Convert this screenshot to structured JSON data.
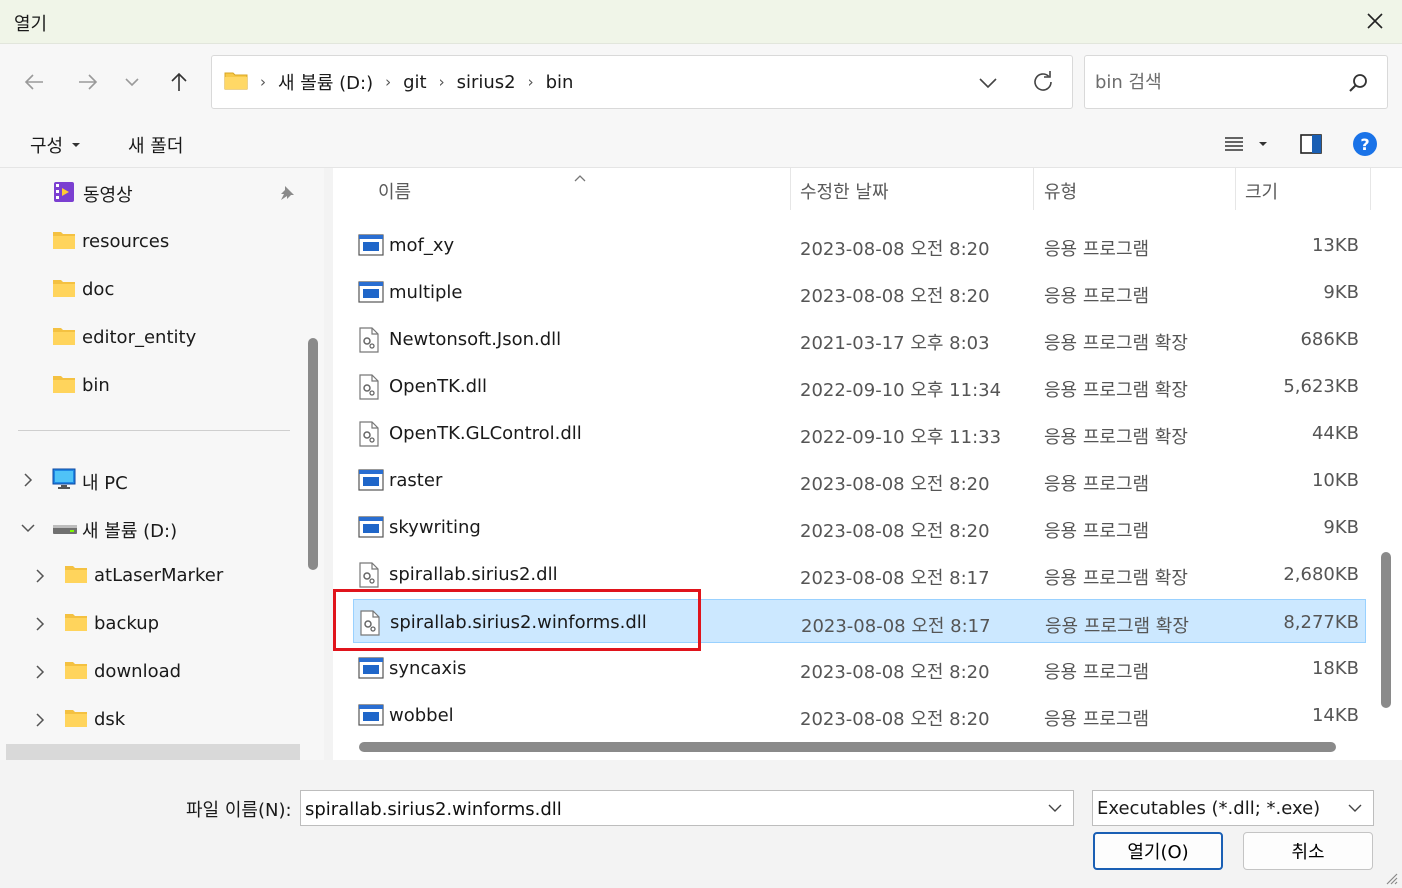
{
  "window": {
    "title": "열기"
  },
  "nav": {
    "breadcrumbs": [
      "새 볼륨 (D:)",
      "git",
      "sirius2",
      "bin"
    ],
    "search_placeholder": "bin 검색"
  },
  "toolbar": {
    "organize_label": "구성",
    "new_folder_label": "새 폴더"
  },
  "sidebar": {
    "quick": [
      {
        "label": "동영상",
        "icon": "video-folder-icon",
        "pinned": true
      },
      {
        "label": "resources",
        "icon": "folder-icon"
      },
      {
        "label": "doc",
        "icon": "folder-icon"
      },
      {
        "label": "editor_entity",
        "icon": "folder-icon"
      },
      {
        "label": "bin",
        "icon": "folder-icon"
      }
    ],
    "tree": [
      {
        "label": "내 PC",
        "icon": "pc-icon",
        "expanded": false
      },
      {
        "label": "새 볼륨 (D:)",
        "icon": "drive-icon",
        "expanded": true
      },
      {
        "label": "atLaserMarker",
        "icon": "folder-icon"
      },
      {
        "label": "backup",
        "icon": "folder-icon"
      },
      {
        "label": "download",
        "icon": "folder-icon"
      },
      {
        "label": "dsk",
        "icon": "folder-icon"
      }
    ]
  },
  "columns": {
    "name": "이름",
    "date": "수정한 날짜",
    "type": "유형",
    "size": "크기"
  },
  "files": [
    {
      "name": "mof_xy",
      "date": "2023-08-08 오전 8:20",
      "type": "응용 프로그램",
      "size": "13KB",
      "kind": "exe"
    },
    {
      "name": "multiple",
      "date": "2023-08-08 오전 8:20",
      "type": "응용 프로그램",
      "size": "9KB",
      "kind": "exe"
    },
    {
      "name": "Newtonsoft.Json.dll",
      "date": "2021-03-17 오후 8:03",
      "type": "응용 프로그램 확장",
      "size": "686KB",
      "kind": "dll"
    },
    {
      "name": "OpenTK.dll",
      "date": "2022-09-10 오후 11:34",
      "type": "응용 프로그램 확장",
      "size": "5,623KB",
      "kind": "dll"
    },
    {
      "name": "OpenTK.GLControl.dll",
      "date": "2022-09-10 오후 11:33",
      "type": "응용 프로그램 확장",
      "size": "44KB",
      "kind": "dll"
    },
    {
      "name": "raster",
      "date": "2023-08-08 오전 8:20",
      "type": "응용 프로그램",
      "size": "10KB",
      "kind": "exe"
    },
    {
      "name": "skywriting",
      "date": "2023-08-08 오전 8:20",
      "type": "응용 프로그램",
      "size": "9KB",
      "kind": "exe"
    },
    {
      "name": "spirallab.sirius2.dll",
      "date": "2023-08-08 오전 8:17",
      "type": "응용 프로그램 확장",
      "size": "2,680KB",
      "kind": "dll"
    },
    {
      "name": "spirallab.sirius2.winforms.dll",
      "date": "2023-08-08 오전 8:17",
      "type": "응용 프로그램 확장",
      "size": "8,277KB",
      "kind": "dll",
      "selected": true
    },
    {
      "name": "syncaxis",
      "date": "2023-08-08 오전 8:20",
      "type": "응용 프로그램",
      "size": "18KB",
      "kind": "exe"
    },
    {
      "name": "wobbel",
      "date": "2023-08-08 오전 8:20",
      "type": "응용 프로그램",
      "size": "14KB",
      "kind": "exe"
    }
  ],
  "footer": {
    "filename_label": "파일 이름(N):",
    "filename_value": "spirallab.sirius2.winforms.dll",
    "filter_value": "Executables (*.dll; *.exe)",
    "open_label": "열기(O)",
    "cancel_label": "취소"
  },
  "colors": {
    "selection": "#cce8ff",
    "highlight_box": "#e0141c",
    "accent": "#1a73e8"
  }
}
